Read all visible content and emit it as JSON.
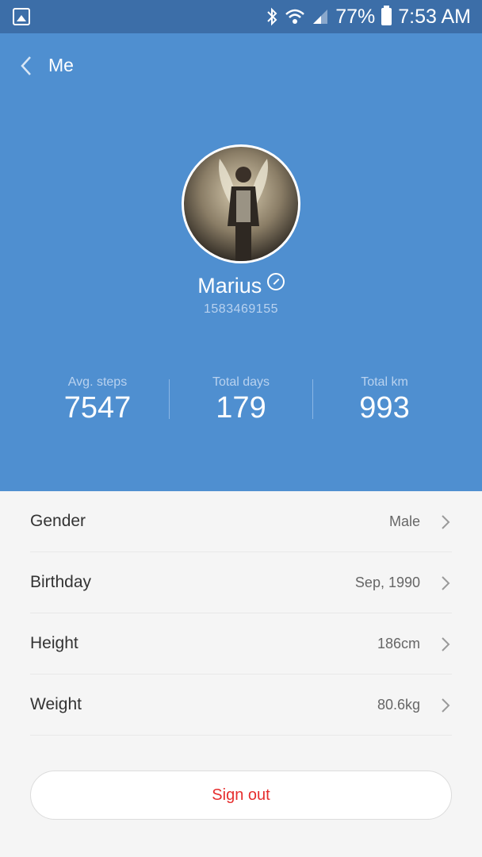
{
  "status_bar": {
    "battery": "77%",
    "time": "7:53 AM"
  },
  "header": {
    "title": "Me"
  },
  "profile": {
    "name": "Marius",
    "id": "1583469155"
  },
  "stats": [
    {
      "label": "Avg. steps",
      "value": "7547"
    },
    {
      "label": "Total days",
      "value": "179"
    },
    {
      "label": "Total  km",
      "value": "993"
    }
  ],
  "list": [
    {
      "label": "Gender",
      "value": "Male"
    },
    {
      "label": "Birthday",
      "value": "Sep, 1990"
    },
    {
      "label": "Height",
      "value": "186cm"
    },
    {
      "label": "Weight",
      "value": "80.6kg"
    }
  ],
  "signout_label": "Sign out",
  "colors": {
    "header_bg": "#4f8fd0",
    "statusbar_bg": "#3c6ea8",
    "signout_text": "#e62e2e"
  }
}
